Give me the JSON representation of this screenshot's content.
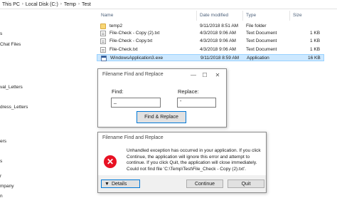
{
  "breadcrumb": [
    "This PC",
    "Local Disk (C:)",
    "Temp",
    "Test"
  ],
  "columns": {
    "name": "Name",
    "date": "Date modified",
    "type": "Type",
    "size": "Size"
  },
  "nav": [
    {
      "label": "s"
    },
    {
      "label": "Chat Files"
    },
    {
      "label": "val_Letters"
    },
    {
      "label": "dress_Letters"
    },
    {
      "label": "ers"
    },
    {
      "label": "s"
    },
    {
      "label": "r"
    },
    {
      "label": "mpany"
    },
    {
      "label": "n"
    }
  ],
  "files": [
    {
      "name": "temp2",
      "date": "9/11/2018 8:51 AM",
      "type": "File folder",
      "size": "",
      "icon": "folder-icon"
    },
    {
      "name": "File-Check - Copy (2).txt",
      "date": "4/3/2018 9:06 AM",
      "type": "Text Document",
      "size": "1 KB",
      "icon": "text-document-icon"
    },
    {
      "name": "File-Check - Copy.txt",
      "date": "4/3/2018 9:06 AM",
      "type": "Text Document",
      "size": "1 KB",
      "icon": "text-document-icon"
    },
    {
      "name": "File-Check.txt",
      "date": "4/3/2018 9:06 AM",
      "type": "Text Document",
      "size": "1 KB",
      "icon": "text-document-icon"
    },
    {
      "name": "WindowsApplication3.exe",
      "date": "9/11/2018 8:59 AM",
      "type": "Application",
      "size": "16 KB",
      "icon": "application-icon"
    }
  ],
  "find_dialog": {
    "title": "Filename Find and Replace",
    "find_label": "Find:",
    "find_value": "_",
    "replace_label": "Replace:",
    "replace_value": "-",
    "button_label": "Find & Replace"
  },
  "error_dialog": {
    "title": "Filename Find and Replace",
    "message": "Unhandled exception has occurred in your application. If you click Continue, the application will ignore this error and attempt to continue. If you click Quit, the application will close immediately.",
    "detail": "Could not find file 'C:\\Temp\\Test\\File_Check - Copy (2).txt'.",
    "details_label": "Details",
    "continue_label": "Continue",
    "quit_label": "Quit"
  },
  "colors": {
    "selection": "#cce8ff",
    "accent": "#0078d7",
    "error": "#e81123"
  }
}
